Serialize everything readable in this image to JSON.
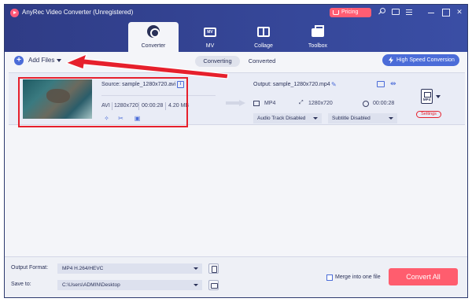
{
  "app": {
    "title": "AnyRec Video Converter (Unregistered)",
    "pricing_label": "Pricing"
  },
  "nav": {
    "tabs": [
      {
        "label": "Converter",
        "icon": "converter-icon",
        "active": true
      },
      {
        "label": "MV",
        "icon": "mv-icon",
        "active": false
      },
      {
        "label": "Collage",
        "icon": "collage-icon",
        "active": false
      },
      {
        "label": "Toolbox",
        "icon": "toolbox-icon",
        "active": false
      }
    ]
  },
  "toolbar": {
    "add_files_label": "Add Files",
    "segments": [
      "Converting",
      "Converted"
    ],
    "active_segment": "Converting",
    "high_speed_label": "High Speed Conversion"
  },
  "file": {
    "source_label": "Source: sample_1280x720.avi",
    "source_format": "AVI",
    "source_resolution": "1280x720",
    "source_duration": "00:00:28",
    "source_size": "4.20 MB",
    "output_label": "Output: sample_1280x720.mp4",
    "output_format": "MP4",
    "output_resolution": "1280x720",
    "output_duration": "00:00:28",
    "audio_track": "Audio Track Disabled",
    "subtitle": "Subtitle Disabled",
    "format_badge": "MP4",
    "settings_label": "Settings"
  },
  "footer": {
    "output_format_label": "Output Format:",
    "output_format_value": "MP4 H.264/HEVC",
    "save_to_label": "Save to:",
    "save_to_value": "C:\\Users\\ADMIN\\Desktop",
    "merge_label": "Merge into one file",
    "convert_all_label": "Convert All"
  },
  "colors": {
    "header": "#2f3c86",
    "accent": "#4b6cd8",
    "convert_button": "#ff5d6e",
    "highlight": "#e6202c"
  }
}
